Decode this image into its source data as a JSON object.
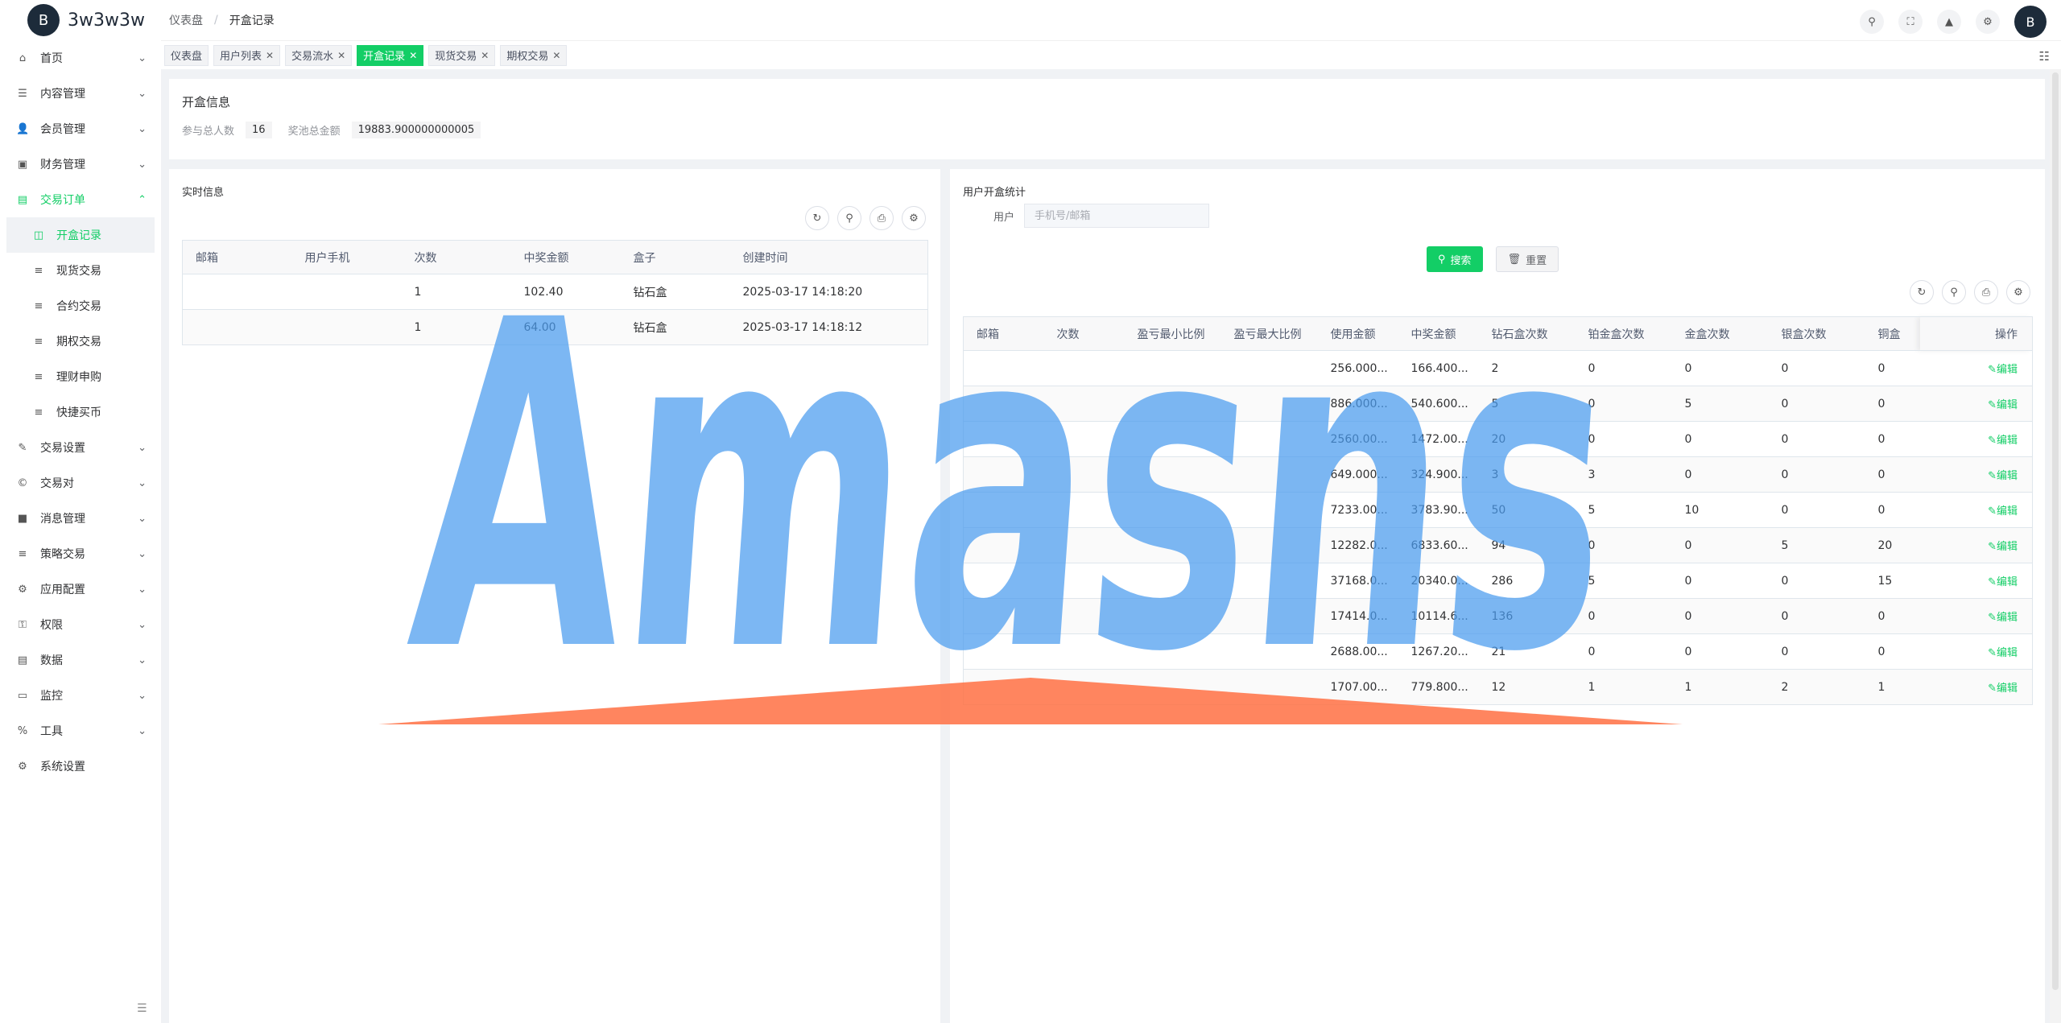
{
  "app": {
    "title": "3w3w3w",
    "logo_glyph": "B"
  },
  "breadcrumb": {
    "items": [
      "仪表盘",
      "开盒记录"
    ],
    "sep": "/"
  },
  "header_icons": [
    "search-icon",
    "fullscreen-icon",
    "bell-icon",
    "settings-icon"
  ],
  "tags": [
    {
      "label": "仪表盘",
      "closable": false,
      "active": false
    },
    {
      "label": "用户列表",
      "closable": true,
      "active": false
    },
    {
      "label": "交易流水",
      "closable": true,
      "active": false
    },
    {
      "label": "开盒记录",
      "closable": true,
      "active": true
    },
    {
      "label": "现货交易",
      "closable": true,
      "active": false
    },
    {
      "label": "期权交易",
      "closable": true,
      "active": false
    }
  ],
  "sidebar": {
    "items": [
      {
        "label": "首页",
        "icon": "⌂"
      },
      {
        "label": "内容管理",
        "icon": "☰"
      },
      {
        "label": "会员管理",
        "icon": "👤"
      },
      {
        "label": "财务管理",
        "icon": "▣"
      },
      {
        "label": "交易订单",
        "icon": "▤"
      },
      {
        "label": "交易设置",
        "icon": "✎"
      },
      {
        "label": "交易对",
        "icon": "©"
      },
      {
        "label": "消息管理",
        "icon": "■"
      },
      {
        "label": "策略交易",
        "icon": "≡"
      },
      {
        "label": "应用配置",
        "icon": "⚙"
      },
      {
        "label": "权限",
        "icon": "⚿"
      },
      {
        "label": "数据",
        "icon": "▤"
      },
      {
        "label": "监控",
        "icon": "▭"
      },
      {
        "label": "工具",
        "icon": "%"
      },
      {
        "label": "系统设置",
        "icon": "⚙"
      }
    ],
    "sub_items": [
      {
        "label": "开盒记录",
        "icon": "◫"
      },
      {
        "label": "现货交易",
        "icon": "≡"
      },
      {
        "label": "合约交易",
        "icon": "≡"
      },
      {
        "label": "期权交易",
        "icon": "≡"
      },
      {
        "label": "理财申购",
        "icon": "≡"
      },
      {
        "label": "快捷买币",
        "icon": "≡"
      }
    ]
  },
  "info": {
    "title": "开盒信息",
    "participants_label": "参与总人数",
    "participants_value": "16",
    "pool_label": "奖池总金额",
    "pool_value": "19883.900000000005"
  },
  "realtime": {
    "title": "实时信息",
    "columns": [
      "邮箱",
      "用户手机",
      "次数",
      "中奖金额",
      "盒子",
      "创建时间"
    ],
    "rows": [
      [
        "",
        "",
        "1",
        "102.40",
        "钻石盒",
        "2025-03-17 14:18:20"
      ],
      [
        "",
        "",
        "1",
        "64.00",
        "钻石盒",
        "2025-03-17 14:18:12"
      ]
    ]
  },
  "stats": {
    "title": "用户开盒统计",
    "user_label": "用户",
    "user_placeholder": "手机号/邮箱",
    "search_label": "搜索",
    "reset_label": "重置",
    "columns": [
      "邮箱",
      "次数",
      "盈亏最小比例",
      "盈亏最大比例",
      "使用金额",
      "中奖金额",
      "钻石盒次数",
      "铂金盒次数",
      "金盒次数",
      "银盒次数",
      "铜盒",
      "操作"
    ],
    "edit_label": "编辑",
    "rows": [
      [
        "",
        "",
        "",
        "",
        "256.000...",
        "166.400...",
        "2",
        "0",
        "0",
        "0",
        "0"
      ],
      [
        "",
        "",
        "",
        "",
        "886.000...",
        "540.600...",
        "5",
        "0",
        "5",
        "0",
        "0"
      ],
      [
        "",
        "",
        "",
        "",
        "2560.00...",
        "1472.00...",
        "20",
        "0",
        "0",
        "0",
        "0"
      ],
      [
        "",
        "",
        "",
        "",
        "649.000...",
        "324.900...",
        "3",
        "3",
        "0",
        "0",
        "0"
      ],
      [
        "",
        "",
        "",
        "",
        "7233.00...",
        "3783.90...",
        "50",
        "5",
        "10",
        "0",
        "0"
      ],
      [
        "",
        "",
        "",
        "",
        "12282.0...",
        "6833.60...",
        "94",
        "0",
        "0",
        "5",
        "20"
      ],
      [
        "",
        "",
        "",
        "",
        "37168.0...",
        "20340.0...",
        "286",
        "5",
        "0",
        "0",
        "15"
      ],
      [
        "",
        "",
        "",
        "",
        "17414.0...",
        "10114.6...",
        "136",
        "0",
        "0",
        "0",
        "0"
      ],
      [
        "",
        "",
        "",
        "",
        "2688.00...",
        "1267.20...",
        "21",
        "0",
        "0",
        "0",
        "0"
      ],
      [
        "",
        "",
        "",
        "",
        "1707.00...",
        "779.800...",
        "12",
        "1",
        "1",
        "2",
        "1"
      ]
    ]
  },
  "watermark": {
    "text": "Amasns",
    "text_color": "#4a9bef",
    "shape_color": "#ff7043"
  },
  "colors": {
    "accent": "#13ce66"
  }
}
